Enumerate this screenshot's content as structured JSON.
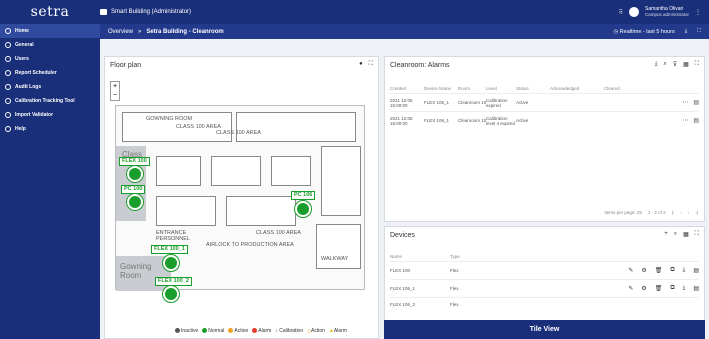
{
  "app": {
    "logo": "setra",
    "title": "Smart Building (Administrator)"
  },
  "user": {
    "name": "Samantha Olivari",
    "role": "Campus administrator"
  },
  "sidebar": {
    "items": [
      {
        "label": "Home"
      },
      {
        "label": "General"
      },
      {
        "label": "Users"
      },
      {
        "label": "Report Scheduler"
      },
      {
        "label": "Audit Logs"
      },
      {
        "label": "Calibration Tracking Tool"
      },
      {
        "label": "Import Validator"
      },
      {
        "label": "Help"
      }
    ]
  },
  "breadcrumb": {
    "first": "Overview",
    "sep": "»",
    "current": "Setra Building - Cleanroom"
  },
  "realtime": {
    "label": "Realtime - last 5 hours"
  },
  "floorplan": {
    "title": "Floor plan",
    "rooms": [
      "Class",
      "Gowning Room"
    ],
    "labels": {
      "tl1": "GOWNING ROOM",
      "tl2": "CLASS 100 AREA",
      "tl3": "CLASS 100 AREA",
      "bl1": "ENTRANCE",
      "bl2": "PERSONNEL",
      "bl3": "AIRLOCK TO PRODUCTION AREA",
      "bl4": "CLASS 100 AREA",
      "br": "WALKWAY"
    },
    "tags": [
      "FLEX 100",
      "PC 100",
      "PC 106",
      "FLEX 100_1",
      "FLEX 100_2"
    ],
    "legend": [
      "Inactive",
      "Normal",
      "Action",
      "Alarm",
      "Calibration",
      "Action",
      "Alarm"
    ]
  },
  "alarms": {
    "title": "Cleanroom: Alarms",
    "columns": [
      "Created",
      "Device Name",
      "Room",
      "Level",
      "Status",
      "Acknowledged",
      "Cleared"
    ],
    "rows": [
      {
        "created": "2021 12:05 15:00:00",
        "device": "FLEX 106_1",
        "room": "Cleanroom 106",
        "level": "Calibration expired",
        "status": "Active"
      },
      {
        "created": "2021 12:05 15:00:00",
        "device": "FLEX 106_1",
        "room": "Cleanroom 106",
        "level": "Calibration level 4 expired",
        "status": "Active"
      }
    ],
    "pager": {
      "per_page": "Items per page: 25",
      "range": "1 - 2 of 2"
    }
  },
  "devices": {
    "title": "Devices",
    "columns": [
      "Name",
      "Type"
    ],
    "rows": [
      {
        "name": "FLEX 100",
        "type": "Flex"
      },
      {
        "name": "FLEX 106_1",
        "type": "Flex"
      },
      {
        "name": "FLEX 106_2",
        "type": "Flex"
      }
    ]
  },
  "tileview": {
    "label": "Tile View"
  },
  "colors": {
    "brand": "#1a2f7a",
    "normal": "#1a9e2b",
    "action": "#f0a020",
    "alarm": "#e53b2c",
    "inactive": "#555555"
  }
}
